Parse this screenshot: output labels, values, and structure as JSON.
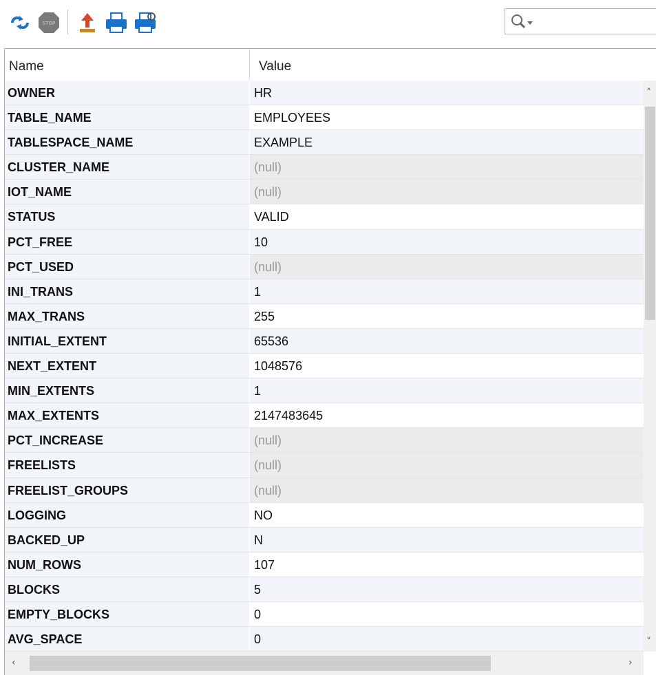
{
  "toolbar": {
    "icons": [
      "refresh-icon",
      "stop-icon",
      "export-icon",
      "print-icon",
      "print-preview-icon"
    ],
    "stop_label": "STOP",
    "search_placeholder": ""
  },
  "grid": {
    "headers": {
      "name": "Name",
      "value": "Value"
    },
    "rows": [
      {
        "name": "OWNER",
        "value": "HR"
      },
      {
        "name": "TABLE_NAME",
        "value": "EMPLOYEES"
      },
      {
        "name": "TABLESPACE_NAME",
        "value": "EXAMPLE"
      },
      {
        "name": "CLUSTER_NAME",
        "value": "(null)"
      },
      {
        "name": "IOT_NAME",
        "value": "(null)"
      },
      {
        "name": "STATUS",
        "value": "VALID"
      },
      {
        "name": "PCT_FREE",
        "value": "10"
      },
      {
        "name": "PCT_USED",
        "value": "(null)"
      },
      {
        "name": "INI_TRANS",
        "value": "1"
      },
      {
        "name": "MAX_TRANS",
        "value": "255"
      },
      {
        "name": "INITIAL_EXTENT",
        "value": "65536"
      },
      {
        "name": "NEXT_EXTENT",
        "value": "1048576"
      },
      {
        "name": "MIN_EXTENTS",
        "value": "1"
      },
      {
        "name": "MAX_EXTENTS",
        "value": "2147483645"
      },
      {
        "name": "PCT_INCREASE",
        "value": "(null)"
      },
      {
        "name": "FREELISTS",
        "value": "(null)"
      },
      {
        "name": "FREELIST_GROUPS",
        "value": "(null)"
      },
      {
        "name": "LOGGING",
        "value": "NO"
      },
      {
        "name": "BACKED_UP",
        "value": "N"
      },
      {
        "name": "NUM_ROWS",
        "value": "107"
      },
      {
        "name": "BLOCKS",
        "value": "5"
      },
      {
        "name": "EMPTY_BLOCKS",
        "value": "0"
      },
      {
        "name": "AVG_SPACE",
        "value": "0"
      }
    ]
  },
  "colors": {
    "accent_blue": "#1a73c9",
    "stop_gray": "#7a7a7a",
    "export_red": "#d9472b",
    "row_alt": "#f2f5fa",
    "null_bg": "#ebebeb",
    "null_text": "#9a9a9a"
  }
}
